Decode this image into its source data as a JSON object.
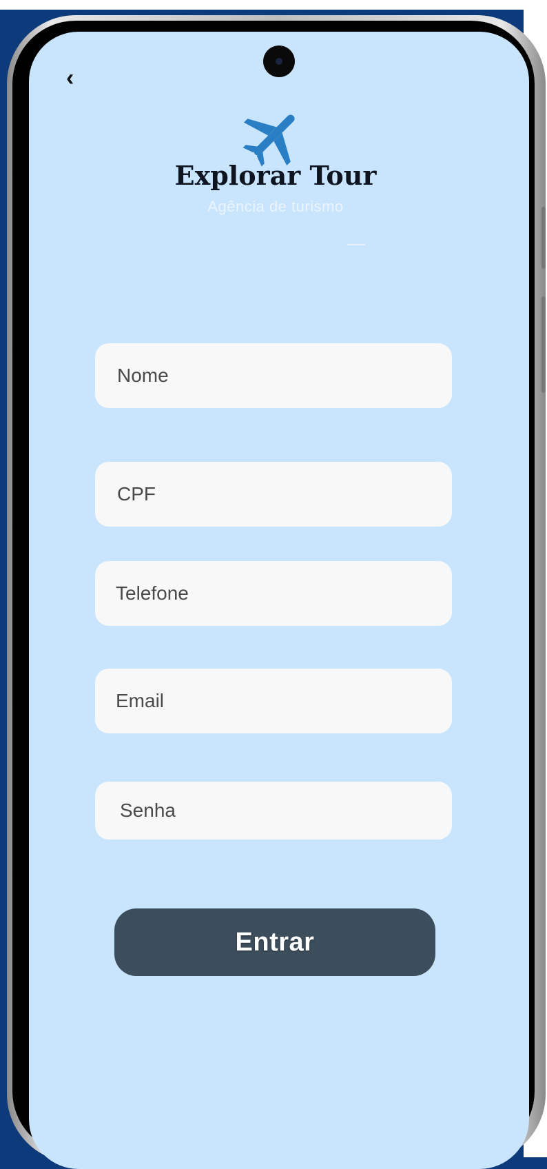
{
  "app": {
    "brand_title": "Explorar Tour",
    "brand_subtitle": "Agência de turismo"
  },
  "navigation": {
    "back_icon": "chevron-left-icon",
    "back_glyph": "‹"
  },
  "logo": {
    "icon": "airplane-icon",
    "color": "#2a7fc4"
  },
  "form": {
    "fields": [
      {
        "name": "nome",
        "placeholder": "Nome",
        "value": ""
      },
      {
        "name": "cpf",
        "placeholder": "CPF",
        "value": ""
      },
      {
        "name": "telefone",
        "placeholder": "Telefone",
        "value": ""
      },
      {
        "name": "email",
        "placeholder": "Email",
        "value": ""
      },
      {
        "name": "senha",
        "placeholder": "Senha",
        "value": ""
      }
    ],
    "submit_label": "Entrar"
  },
  "colors": {
    "screen_background": "#c8e5fd",
    "field_background": "#f8f8f9",
    "button_background": "#3c4d5c",
    "outer_background": "#0d3a7a"
  }
}
